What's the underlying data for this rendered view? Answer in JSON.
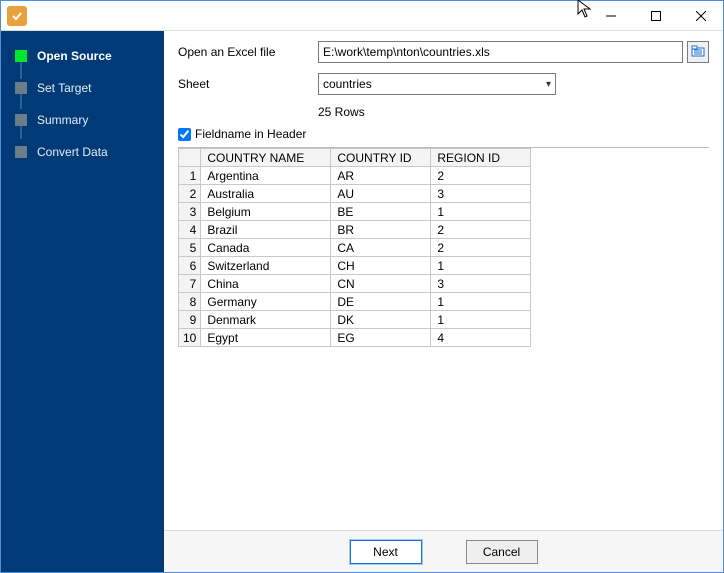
{
  "titlebar": {
    "title": ""
  },
  "sidebar": {
    "steps": [
      {
        "label": "Open Source",
        "active": true
      },
      {
        "label": "Set Target",
        "active": false
      },
      {
        "label": "Summary",
        "active": false
      },
      {
        "label": "Convert Data",
        "active": false
      }
    ]
  },
  "form": {
    "open_label": "Open an Excel file",
    "path_value": "E:\\work\\temp\\nton\\countries.xls",
    "sheet_label": "Sheet",
    "sheet_value": "countries",
    "rows_label": "25 Rows",
    "fieldname_label": "Fieldname in Header",
    "fieldname_checked": true
  },
  "grid": {
    "headers": [
      "COUNTRY NAME",
      "COUNTRY ID",
      "REGION ID"
    ],
    "rows": [
      {
        "n": "1",
        "c": [
          "Argentina",
          "AR",
          "2"
        ]
      },
      {
        "n": "2",
        "c": [
          "Australia",
          "AU",
          "3"
        ]
      },
      {
        "n": "3",
        "c": [
          "Belgium",
          "BE",
          "1"
        ]
      },
      {
        "n": "4",
        "c": [
          "Brazil",
          "BR",
          "2"
        ]
      },
      {
        "n": "5",
        "c": [
          "Canada",
          "CA",
          "2"
        ]
      },
      {
        "n": "6",
        "c": [
          "Switzerland",
          "CH",
          "1"
        ]
      },
      {
        "n": "7",
        "c": [
          "China",
          "CN",
          "3"
        ]
      },
      {
        "n": "8",
        "c": [
          "Germany",
          "DE",
          "1"
        ]
      },
      {
        "n": "9",
        "c": [
          "Denmark",
          "DK",
          "1"
        ]
      },
      {
        "n": "10",
        "c": [
          "Egypt",
          "EG",
          "4"
        ]
      }
    ]
  },
  "footer": {
    "next_label": "Next",
    "cancel_label": "Cancel"
  }
}
